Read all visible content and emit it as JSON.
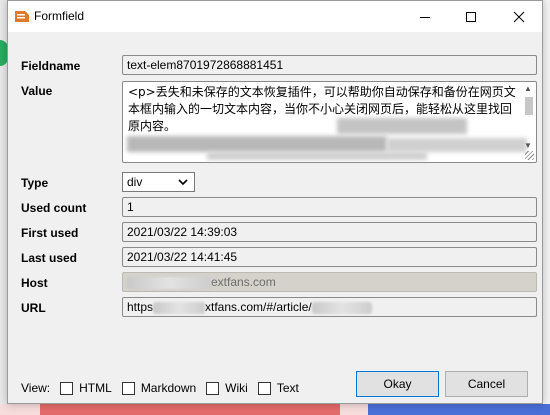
{
  "window": {
    "title": "Formfield"
  },
  "fields": {
    "fieldname": {
      "label": "Fieldname",
      "value": "text-elem8701972868881451"
    },
    "value": {
      "label": "Value",
      "text": "<p>丢失和未保存的文本恢复插件，可以帮助你自动保存和备份在网页文本框内输入的一切文本内容，当你不小心关闭网页后，能轻松从这里找回原内容。"
    },
    "type": {
      "label": "Type",
      "selected": "div"
    },
    "used_count": {
      "label": "Used count",
      "value": "1"
    },
    "first_used": {
      "label": "First used",
      "value": "2021/03/22 14:39:03"
    },
    "last_used": {
      "label": "Last used",
      "value": "2021/03/22 14:41:45"
    },
    "host": {
      "label": "Host",
      "value_visible": "extfans.com"
    },
    "url": {
      "label": "URL",
      "value_prefix": "https",
      "value_middle": "xtfans.com/#/article/"
    }
  },
  "footer": {
    "view_label": "View:",
    "options": [
      {
        "label": "HTML",
        "checked": false
      },
      {
        "label": "Markdown",
        "checked": false
      },
      {
        "label": "Wiki",
        "checked": false
      },
      {
        "label": "Text",
        "checked": false
      }
    ]
  },
  "buttons": {
    "ok": "Okay",
    "cancel": "Cancel"
  },
  "colors": {
    "accent": "#0078d7",
    "app_icon": "#e07a2a"
  }
}
